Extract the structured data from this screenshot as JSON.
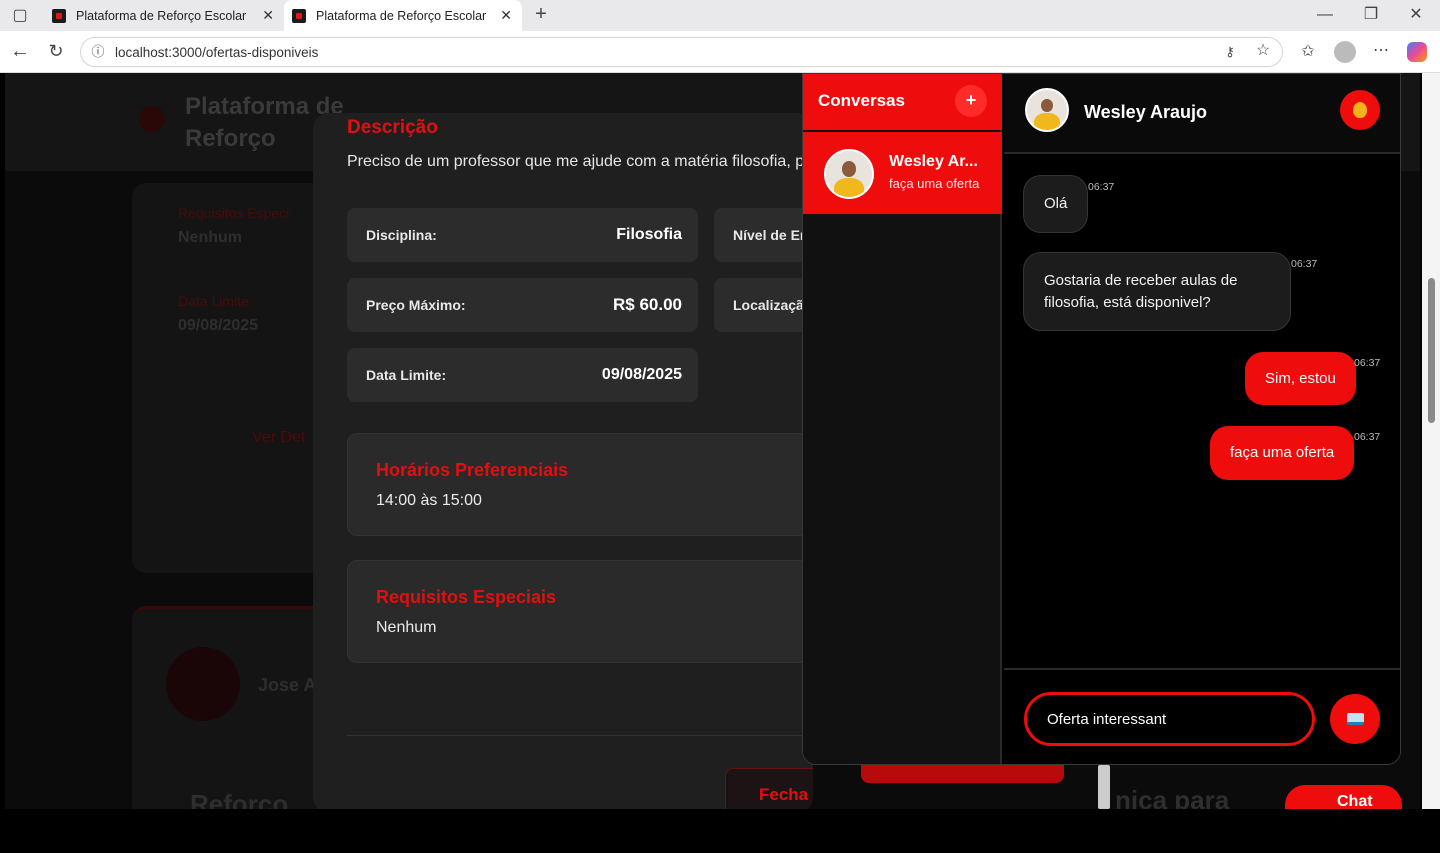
{
  "browser": {
    "tabs": [
      {
        "title": "Plataforma de Reforço Escolar"
      },
      {
        "title": "Plataforma de Reforço Escolar"
      }
    ],
    "url": "localhost:3000/ofertas-disponiveis"
  },
  "background": {
    "brand": "Plataforma de Reforço",
    "card1": {
      "req_label": "Requisitos Especi",
      "req_value": "Nenhum",
      "date_label": "Data Limite:",
      "date_value": "09/08/2025",
      "details_link": "Ver Det"
    },
    "card2": {
      "user_name": "Jose A",
      "title": "Reforço",
      "title_right": "nica para"
    },
    "chat_button": "Chat"
  },
  "modal": {
    "description_title": "Descrição",
    "description_text": "Preciso de um professor que me ajude com a matéria filosofia, p",
    "fields": [
      {
        "label": "Disciplina:",
        "value": "Filosofia"
      },
      {
        "label": "Nível de En",
        "value": ""
      },
      {
        "label": "Preço Máximo:",
        "value": "R$ 60.00"
      },
      {
        "label": "Localizaçã",
        "value": ""
      },
      {
        "label": "Data Limite:",
        "value": "09/08/2025"
      }
    ],
    "schedule": {
      "title": "Horários Preferenciais",
      "value": "14:00 às 15:00"
    },
    "requirements": {
      "title": "Requisitos Especiais",
      "value": "Nenhum"
    },
    "close_label": "Fecha"
  },
  "chat": {
    "conversations_title": "Conversas",
    "add_label": "+",
    "conversation": {
      "name": "Wesley Ar...",
      "last_message": "faça uma oferta"
    },
    "contact_name": "Wesley Araujo",
    "messages": [
      {
        "dir": "in",
        "text": "Olá",
        "time": "06:37"
      },
      {
        "dir": "in",
        "text": "Gostaria de receber aulas de filosofia, está disponivel?",
        "time": "06:37"
      },
      {
        "dir": "out",
        "text": "Sim, estou",
        "time": "06:37"
      },
      {
        "dir": "out",
        "text": "faça uma oferta",
        "time": "06:37"
      }
    ],
    "input_value": "Oferta interessant"
  },
  "colors": {
    "accent": "#ee0c0c",
    "panel": "#1f1f1f"
  }
}
